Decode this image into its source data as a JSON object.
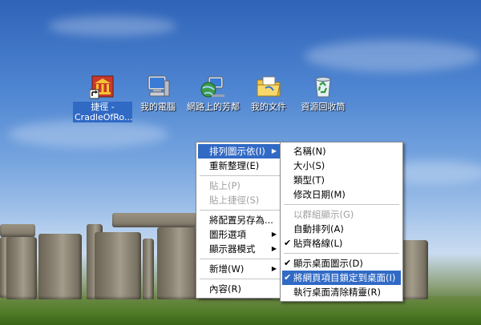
{
  "desktop_icons": [
    {
      "label": "捷徑 - CradleOfRo...",
      "icon": "shortcut-bank-icon",
      "selected": true
    },
    {
      "label": "我的電腦",
      "icon": "my-computer-icon"
    },
    {
      "label": "網路上的芳鄰",
      "icon": "network-places-icon"
    },
    {
      "label": "我的文件",
      "icon": "my-documents-icon"
    },
    {
      "label": "資源回收筒",
      "icon": "recycle-bin-icon"
    }
  ],
  "context_menu": {
    "items": [
      {
        "label": "排列圖示依(I)",
        "submenu": true,
        "highlighted": true
      },
      {
        "label": "重新整理(E)"
      },
      {
        "label": "貼上(P)",
        "disabled": true
      },
      {
        "label": "貼上捷徑(S)",
        "disabled": true
      },
      {
        "label": "將配置另存為..."
      },
      {
        "label": "圖形選項",
        "submenu": true
      },
      {
        "label": "顯示器模式",
        "submenu": true
      },
      {
        "label": "新增(W)",
        "submenu": true
      },
      {
        "label": "內容(R)"
      }
    ]
  },
  "submenu": {
    "items": [
      {
        "label": "名稱(N)"
      },
      {
        "label": "大小(S)"
      },
      {
        "label": "類型(T)"
      },
      {
        "label": "修改日期(M)"
      },
      {
        "label": "以群組顯示(G)",
        "disabled": true
      },
      {
        "label": "自動排列(A)"
      },
      {
        "label": "貼齊格線(L)",
        "checked": true
      },
      {
        "label": "顯示桌面圖示(D)",
        "checked": true
      },
      {
        "label": "將網頁項目鎖定到桌面(I)",
        "checked": true,
        "highlighted": true
      },
      {
        "label": "執行桌面清除精靈(R)"
      }
    ]
  },
  "colors": {
    "highlight": "#316ac5",
    "menu_bg": "#ffffff",
    "disabled_text": "#a0a0a0"
  }
}
